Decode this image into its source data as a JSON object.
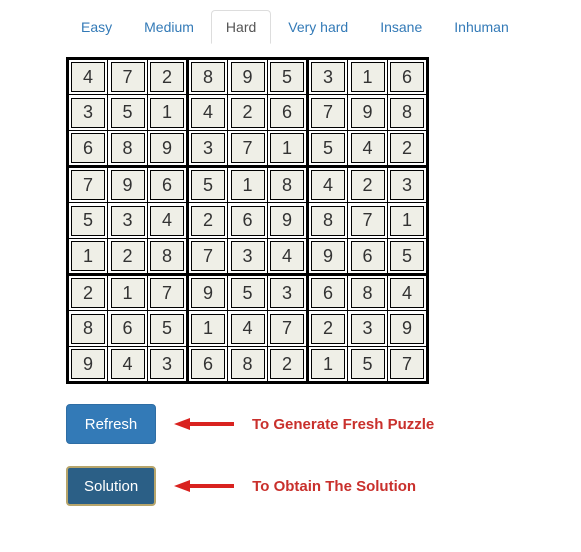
{
  "tabs": {
    "items": [
      {
        "label": "Easy",
        "active": false
      },
      {
        "label": "Medium",
        "active": false
      },
      {
        "label": "Hard",
        "active": true
      },
      {
        "label": "Very hard",
        "active": false
      },
      {
        "label": "Insane",
        "active": false
      },
      {
        "label": "Inhuman",
        "active": false
      }
    ]
  },
  "grid": {
    "rows": [
      [
        4,
        7,
        2,
        8,
        9,
        5,
        3,
        1,
        6
      ],
      [
        3,
        5,
        1,
        4,
        2,
        6,
        7,
        9,
        8
      ],
      [
        6,
        8,
        9,
        3,
        7,
        1,
        5,
        4,
        2
      ],
      [
        7,
        9,
        6,
        5,
        1,
        8,
        4,
        2,
        3
      ],
      [
        5,
        3,
        4,
        2,
        6,
        9,
        8,
        7,
        1
      ],
      [
        1,
        2,
        8,
        7,
        3,
        4,
        9,
        6,
        5
      ],
      [
        2,
        1,
        7,
        9,
        5,
        3,
        6,
        8,
        4
      ],
      [
        8,
        6,
        5,
        1,
        4,
        7,
        2,
        3,
        9
      ],
      [
        9,
        4,
        3,
        6,
        8,
        2,
        1,
        5,
        7
      ]
    ]
  },
  "buttons": {
    "refresh": "Refresh",
    "solution": "Solution"
  },
  "captions": {
    "refresh": "To Generate Fresh Puzzle",
    "solution": "To Obtain The Solution"
  },
  "colors": {
    "link": "#337ab7",
    "accent_red": "#c9302c"
  }
}
